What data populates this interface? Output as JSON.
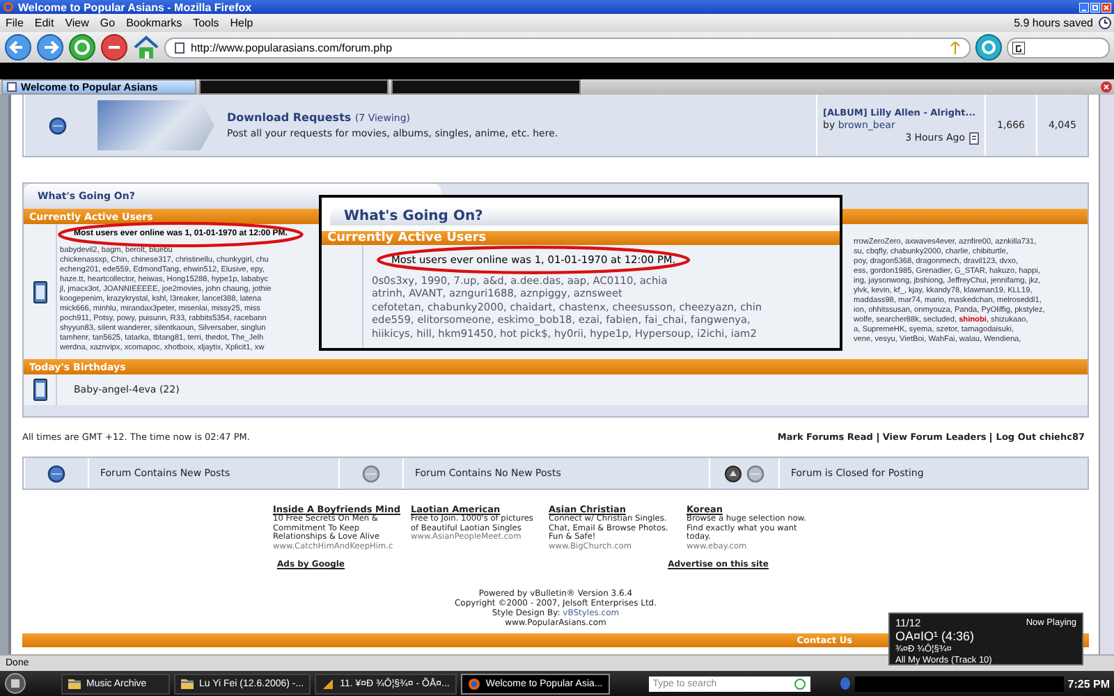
{
  "window": {
    "title": "Welcome to Popular Asians - Mozilla Firefox"
  },
  "menu": [
    "File",
    "Edit",
    "View",
    "Go",
    "Bookmarks",
    "Tools",
    "Help"
  ],
  "toolbar": {
    "saved": "5.9 hours saved",
    "url": "http://www.popularasians.com/forum.php"
  },
  "tabs": [
    {
      "label": "Welcome to Popular Asians",
      "selected": true
    }
  ],
  "forum_row": {
    "title": "Download Requests",
    "viewing": "(7 Viewing)",
    "description": "Post all your requests for movies, albums, singles, anime, etc. here.",
    "last_post": "[ALBUM] Lilly Allen - Alright...",
    "by": "by",
    "user": "brown_bear",
    "time": "3 Hours Ago",
    "threads": "1,666",
    "posts": "4,045"
  },
  "whats_going_on": {
    "title": "What's Going On?",
    "active_header": "Currently Active Users",
    "record": "Most users ever online was 1, 01-01-1970 at 12:00 PM.",
    "users_left": [
      "babydevil2, bagm, berolt, bluebu",
      "chickenassxp, Chin, chinese317, christinellu, chunkygirl, chu",
      "echeng201, ede559, EdmondTang, ehwin512, Elusive, epy,",
      "haze.tt, heartcollector, heiwas, Hong15288, hype1p, lababyc",
      "jl, jmacx3ot, JOANNIEEEEE, joe2movies, john chaung, jothie",
      "koogepenim, krazykrystal, kshl, l3reaker, lancel388, latena",
      "mick666, minhlu, mirandax3peter, misenlai, missy25, miss",
      "poch911, Potsy, powy, puisunn, R33, rabbits5354, racebann",
      "shyyun83, silent wanderer, silentkaoun, Silversaber, singlun",
      "tamhenr, tan5625, tatarka, tbtang81, terri, thedot, The_Jelh",
      "werdna, xaznvipx, xcomapoc, xhotboix, xljaytix, Xplicit1, xw"
    ],
    "users_right": [
      {
        "segments": [
          {
            "text": "rrowZeroZero, axwaves4ever, aznfire00, aznkilla731,"
          }
        ]
      },
      {
        "segments": [
          {
            "text": "su, cbqfly, chabunky2000, charlie, chibiturtle,"
          }
        ]
      },
      {
        "segments": [
          {
            "text": "poy, dragon5368, dragonmech, dravil123, dvxo,"
          }
        ]
      },
      {
        "segments": [
          {
            "text": "ess, gordon1985, Grenadier, G_STAR, hakuzo, happi,"
          }
        ]
      },
      {
        "segments": [
          {
            "text": "ing, jaysonwong, jbshiong, JeffreyChui, jennifamg, jkz,"
          }
        ]
      },
      {
        "segments": [
          {
            "text": "ylvk, kevin, kf_, kjay, kkandy78, klawman19, KLL19,"
          }
        ]
      },
      {
        "segments": [
          {
            "text": "maddass98, mar74, mario, maskedchan, melroseddl1,"
          }
        ]
      },
      {
        "segments": [
          {
            "text": "ion, ohhitssusan, onmyouza, Panda, PyOliffig, pkstylez,"
          }
        ]
      },
      {
        "segments": [
          {
            "text": "wolfe, searcher88k, secluded, "
          },
          {
            "text": "shinobi",
            "color": "#cc0000"
          },
          {
            "text": ", shizukaao,"
          }
        ]
      },
      {
        "segments": [
          {
            "text": "a, SupremeHK, syema, szetor, tamagodaisuki,"
          }
        ]
      },
      {
        "segments": [
          {
            "text": "vene, vesyu, VietBoi, WahFai, walau, Wendiena,"
          }
        ]
      }
    ],
    "birthdays_header": "Today's Birthdays",
    "birthday": "Baby-angel-4eva (22)"
  },
  "popup": {
    "title": "What's Going On?",
    "header": "Currently Active Users",
    "record": "Most users ever online was 1, 01-01-1970 at 12:00 PM.",
    "users": [
      "0s0s3xy, 1990, 7.up, a&d, a.dee.das, aap, AC0110, achia",
      "atrinh, AVANT, aznguri1688, aznpiggy, aznsweet",
      "cefotetan, chabunky2000, chaidart, chastenx, cheesusson, cheezyazn, chin",
      "ede559, elitorsomeone, eskimo_bob18, ezai, fabien, fai_chai, fangwenya,",
      "hiikicys, hill, hkm91450, hot pick$, hy0rii, hype1p, Hypersoup, i2ichi, iam2"
    ]
  },
  "times": {
    "note": "All times are GMT +12. The time now is 02:47 PM.",
    "links": [
      "Mark Forums Read",
      "View Forum Leaders",
      "Log Out chiehc87"
    ]
  },
  "legend": [
    {
      "kind": "new",
      "label": "Forum Contains New Posts"
    },
    {
      "kind": "old",
      "label": "Forum Contains No New Posts"
    },
    {
      "kind": "closed",
      "label": "Forum is Closed for Posting"
    }
  ],
  "ads": [
    {
      "title": "Inside A Boyfriends Mind",
      "text": "10 Free Secrets On Men & Commitment To Keep Relationships & Love Alive",
      "url": "www.CatchHimAndKeepHim.c"
    },
    {
      "title": "Laotian American",
      "text": "Free to Join. 1000's of pictures of Beautiful Laotian Singles",
      "url": "www.AsianPeopleMeet.com"
    },
    {
      "title": "Asian Christian",
      "text": "Connect w/ Christian Singles. Chat, Email & Browse Photos. Fun & Safe!",
      "url": "www.BigChurch.com"
    },
    {
      "title": "Korean",
      "text": "Browse a huge selection now. Find exactly what you want today.",
      "url": "www.ebay.com"
    }
  ],
  "ads_by": "Ads by Google",
  "advertise": "Advertise on this site",
  "credits": [
    "Powered by vBulletin® Version 3.6.4",
    "Copyright ©2000 - 2007, Jelsoft Enterprises Ltd."
  ],
  "style_design": {
    "label": "Style Design By:",
    "link": "vBStyles.com"
  },
  "site": "www.PopularAsians.com",
  "bottom_links": [
    "Contact Us"
  ],
  "status": "Done",
  "now_playing": {
    "track": "11/12",
    "heading": "Now Playing",
    "title": "OA¤IO¹ (4:36)",
    "artist": "¾¤Ð ¾Ô¦§¾¤",
    "album": "All My Words (Track 10)"
  },
  "taskbar": {
    "items": [
      {
        "kind": "folder",
        "label": "Music Archive",
        "selected": false
      },
      {
        "kind": "folder",
        "label": "Lu Yi Fei (12.6.2006) -...",
        "selected": false
      },
      {
        "kind": "player",
        "label": "11. ¥¤Ð ¾Ô¦§¾¤ - ÕÅ¤...",
        "selected": false
      },
      {
        "kind": "browser",
        "label": "Welcome to Popular Asia...",
        "selected": true
      }
    ],
    "search_placeholder": "Type to search",
    "clock": "7:25 PM"
  }
}
